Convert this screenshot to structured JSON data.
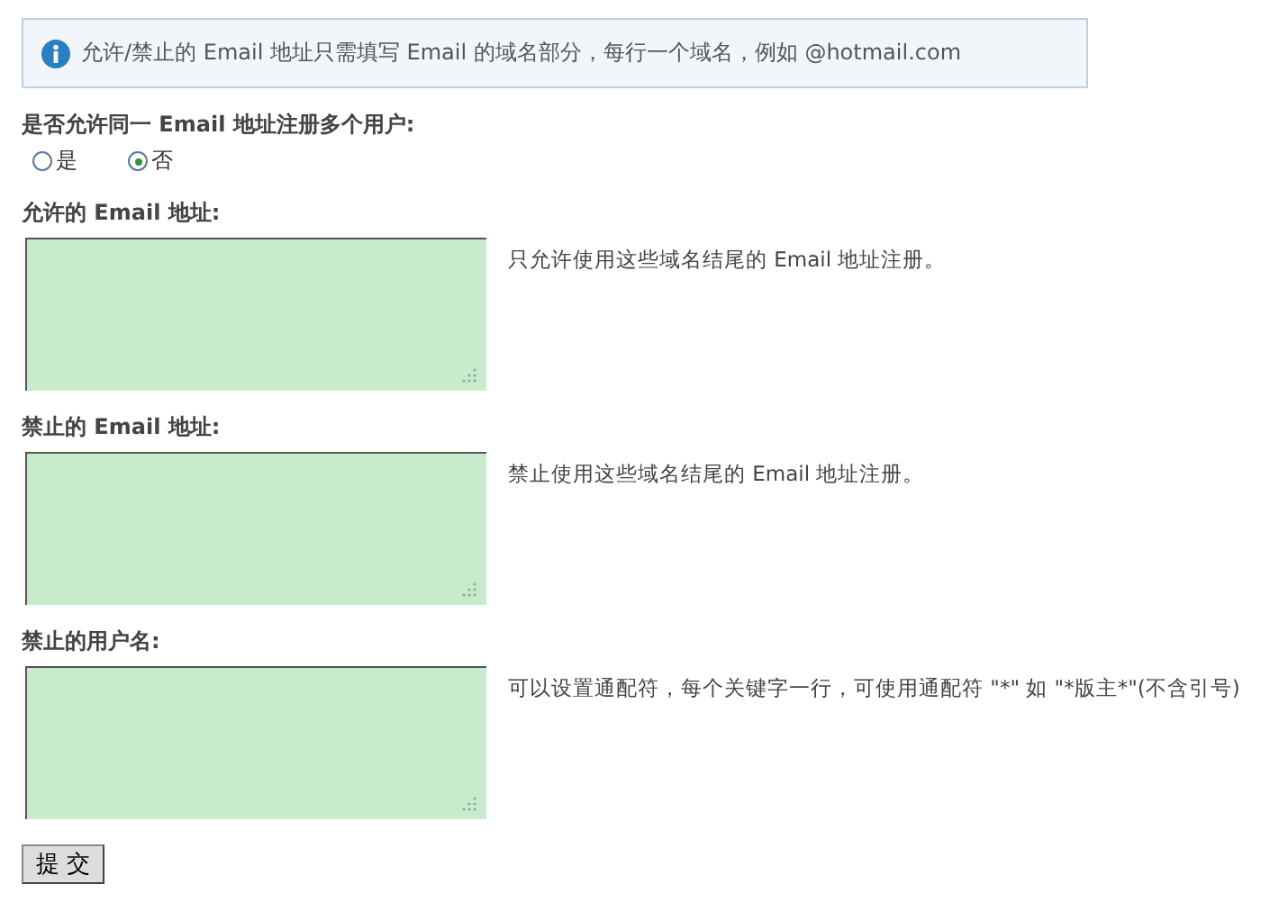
{
  "notice": {
    "text": "允许/禁止的 Email 地址只需填写 Email 的域名部分，每行一个域名，例如 @hotmail.com"
  },
  "multi_user": {
    "label": "是否允许同一 Email 地址注册多个用户:",
    "options": [
      {
        "label": "是",
        "selected": false
      },
      {
        "label": "否",
        "selected": true
      }
    ]
  },
  "fields": [
    {
      "label": "允许的 Email 地址:",
      "hint": "只允许使用这些域名结尾的 Email 地址注册。"
    },
    {
      "label": "禁止的 Email 地址:",
      "hint": "禁止使用这些域名结尾的 Email 地址注册。"
    },
    {
      "label": "禁止的用户名:",
      "hint": "可以设置通配符，每个关键字一行，可使用通配符 \"*\" 如 \"*版主*\"(不含引号)"
    }
  ],
  "submit": {
    "label": "提 交"
  }
}
